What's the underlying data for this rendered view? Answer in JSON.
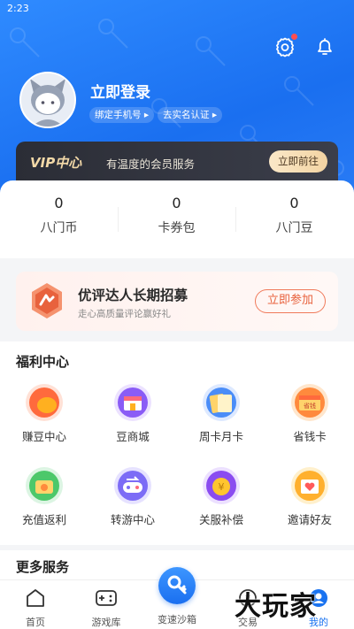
{
  "status_bar": {
    "time": "2:23"
  },
  "header": {
    "login_title": "立即登录",
    "bind_phone": "绑定手机号",
    "verify_name": "去实名认证"
  },
  "vip": {
    "logo": "VIP中心",
    "slogan": "有温度的会员服务",
    "button": "立即前往"
  },
  "stats": [
    {
      "value": "0",
      "label": "八门币"
    },
    {
      "value": "0",
      "label": "卡券包"
    },
    {
      "value": "0",
      "label": "八门豆"
    }
  ],
  "recruit": {
    "title": "优评达人长期招募",
    "subtitle": "走心高质量评论赢好礼",
    "button": "立即参加"
  },
  "welfare": {
    "title": "福利中心",
    "items": [
      {
        "label": "赚豆中心",
        "icon": "bean-icon",
        "color": "#ff6a3d"
      },
      {
        "label": "豆商城",
        "icon": "shop-icon",
        "color": "#8a5cf6"
      },
      {
        "label": "周卡月卡",
        "icon": "card-icon",
        "color": "#4a8df8"
      },
      {
        "label": "省钱卡",
        "icon": "save-card-icon",
        "color": "#ff8a3d"
      },
      {
        "label": "充值返利",
        "icon": "wallet-icon",
        "color": "#4cc86a"
      },
      {
        "label": "转游中心",
        "icon": "transfer-icon",
        "color": "#7c6cf6"
      },
      {
        "label": "关服补偿",
        "icon": "compensation-coin-icon",
        "color": "#8a4cf0"
      },
      {
        "label": "邀请好友",
        "icon": "invite-icon",
        "color": "#ffb02e"
      }
    ]
  },
  "more": {
    "title": "更多服务"
  },
  "tabbar": {
    "items": [
      {
        "label": "首页",
        "icon": "home-icon"
      },
      {
        "label": "游戏库",
        "icon": "gamepad-icon"
      },
      {
        "label": "变速沙箱",
        "icon": "key-icon"
      },
      {
        "label": "交易",
        "icon": "trade-icon"
      },
      {
        "label": "我的",
        "icon": "profile-icon"
      }
    ]
  },
  "watermark": "大玩家",
  "colors": {
    "primary": "#1a73f0",
    "accent_red": "#e8623d",
    "vip_gold": "#f2d3a2"
  }
}
